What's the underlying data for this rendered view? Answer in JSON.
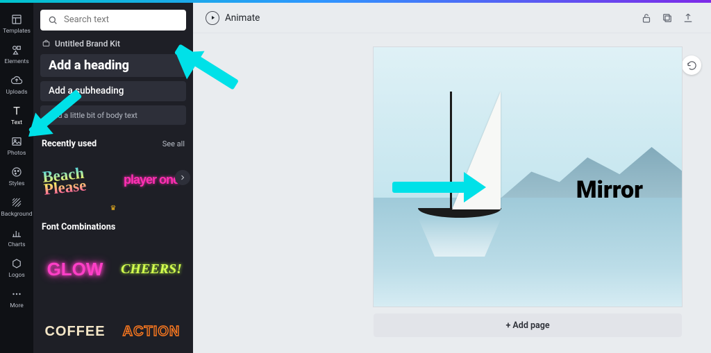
{
  "rail": [
    {
      "label": "Templates"
    },
    {
      "label": "Elements"
    },
    {
      "label": "Uploads"
    },
    {
      "label": "Text"
    },
    {
      "label": "Photos"
    },
    {
      "label": "Styles"
    },
    {
      "label": "Background"
    },
    {
      "label": "Charts"
    },
    {
      "label": "Logos"
    },
    {
      "label": "More"
    }
  ],
  "search": {
    "placeholder": "Search text"
  },
  "brandkit": {
    "label": "Untitled Brand Kit"
  },
  "textbuttons": {
    "heading": "Add a heading",
    "subheading": "Add a subheading",
    "body": "Add a little bit of body text"
  },
  "sections": {
    "recent": {
      "title": "Recently used",
      "seeall": "See all"
    },
    "combos": {
      "title": "Font Combinations"
    }
  },
  "recent_thumbs": [
    "Beach Please",
    "player one"
  ],
  "combo_thumbs": [
    "GLOW",
    "CHEERS!",
    "COFFEE",
    "ACTION"
  ],
  "toolbar": {
    "animate": "Animate"
  },
  "canvas": {
    "mirror": "Mirror",
    "addpage": "+ Add page"
  }
}
